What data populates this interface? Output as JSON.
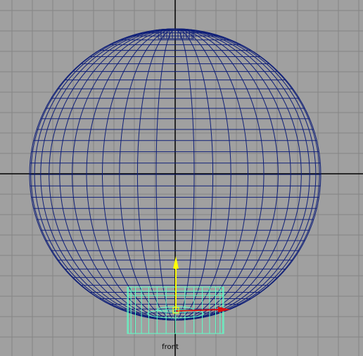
{
  "viewport": {
    "camera_label": "front",
    "colors": {
      "background": "#a0a0a0",
      "grid_line": "#858585",
      "axis_line": "#000000",
      "wireframe": "#0f1f78",
      "selected_object": "#5fffc8",
      "move_handle_y": "#ffff00",
      "move_handle_x": "#d81010"
    },
    "icons": {
      "y_axis_handle": "yellow-arrow",
      "x_axis_handle": "red-arrow"
    }
  }
}
